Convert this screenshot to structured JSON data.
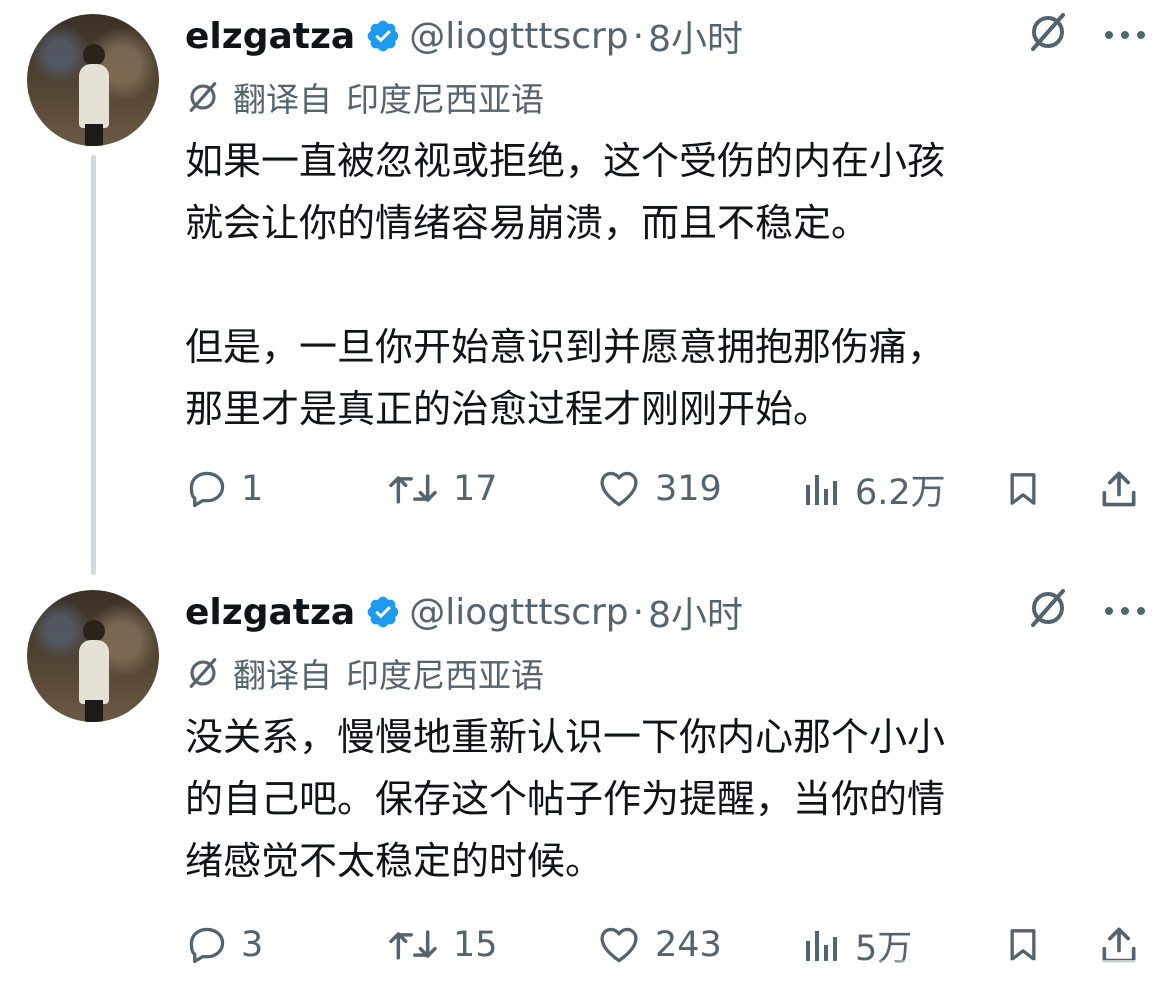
{
  "tweets": [
    {
      "author": {
        "name": "elzgatza",
        "handle": "@liogtttscrp",
        "separator": "·",
        "time": "8小时"
      },
      "translated_label": "翻译自",
      "translated_lang": "印度尼西亚语",
      "text": "如果一直被忽视或拒绝，这个受伤的内在小孩\n就会让你的情绪容易崩溃，而且不稳定。\n\n但是，一旦你开始意识到并愿意拥抱那伤痛，\n那里才是真正的治愈过程才刚刚开始。",
      "replies": "1",
      "reposts": "17",
      "likes": "319",
      "views": "6.2万"
    },
    {
      "author": {
        "name": "elzgatza",
        "handle": "@liogtttscrp",
        "separator": "·",
        "time": "8小时"
      },
      "translated_label": "翻译自",
      "translated_lang": "印度尼西亚语",
      "text": "没关系，慢慢地重新认识一下你内心那个小小\n的自己吧。保存这个帖子作为提醒，当你的情\n绪感觉不太稳定的时候。",
      "replies": "3",
      "reposts": "15",
      "likes": "243",
      "views": "5万"
    }
  ],
  "icons": {
    "verified": "verified-badge-icon",
    "grok": "grok-icon",
    "more": "more-icon",
    "reply": "reply-icon",
    "repost": "repost-icon",
    "like": "heart-icon",
    "views": "views-icon",
    "bookmark": "bookmark-icon",
    "share": "share-icon"
  },
  "colors": {
    "text": "#0f1419",
    "secondary": "#536471",
    "verified": "#1d9bf0",
    "thread_line": "#cfd9de"
  }
}
